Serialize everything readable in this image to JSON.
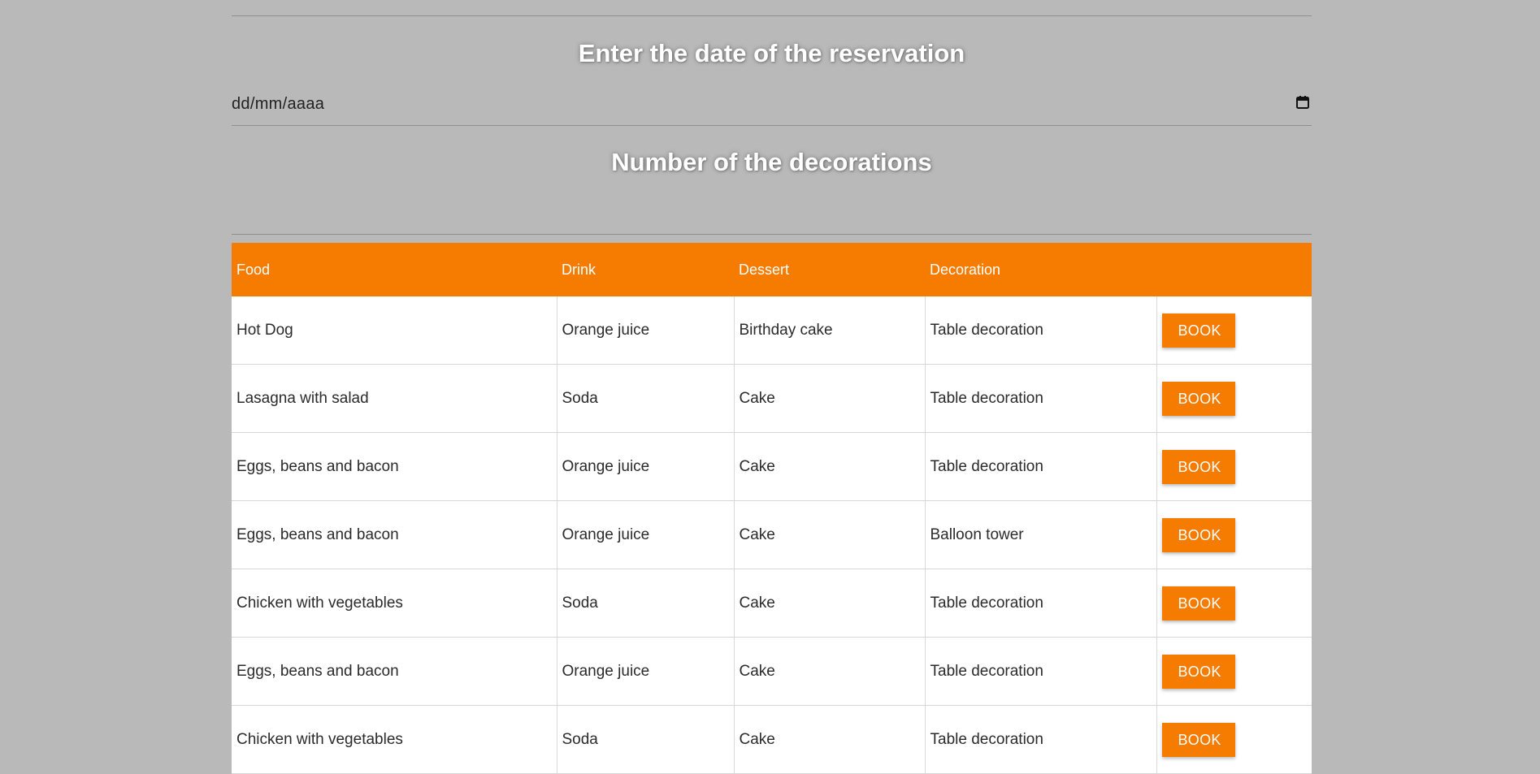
{
  "reservation": {
    "date_heading": "Enter the date of the reservation",
    "date_placeholder": "dd/mm/aaaa",
    "decorations_heading": "Number of the decorations"
  },
  "table": {
    "headers": [
      "Food",
      "Drink",
      "Dessert",
      "Decoration",
      ""
    ],
    "rows": [
      {
        "food": "Hot Dog",
        "drink": "Orange juice",
        "dessert": "Birthday cake",
        "decoration": "Table decoration",
        "action": "BOOK"
      },
      {
        "food": "Lasagna with salad",
        "drink": "Soda",
        "dessert": "Cake",
        "decoration": "Table decoration",
        "action": "BOOK"
      },
      {
        "food": "Eggs, beans and bacon",
        "drink": "Orange juice",
        "dessert": "Cake",
        "decoration": "Table decoration",
        "action": "BOOK"
      },
      {
        "food": "Eggs, beans and bacon",
        "drink": "Orange juice",
        "dessert": "Cake",
        "decoration": "Balloon tower",
        "action": "BOOK"
      },
      {
        "food": "Chicken with vegetables",
        "drink": "Soda",
        "dessert": "Cake",
        "decoration": "Table decoration",
        "action": "BOOK"
      },
      {
        "food": "Eggs, beans and bacon",
        "drink": "Orange juice",
        "dessert": "Cake",
        "decoration": "Table decoration",
        "action": "BOOK"
      },
      {
        "food": "Chicken with vegetables",
        "drink": "Soda",
        "dessert": "Cake",
        "decoration": "Table decoration",
        "action": "BOOK"
      }
    ]
  },
  "colors": {
    "accent": "#f57c00",
    "page_background": "#b9b9b9",
    "row_background": "#ffffff"
  },
  "icons": {
    "date_picker": "calendar-icon"
  }
}
